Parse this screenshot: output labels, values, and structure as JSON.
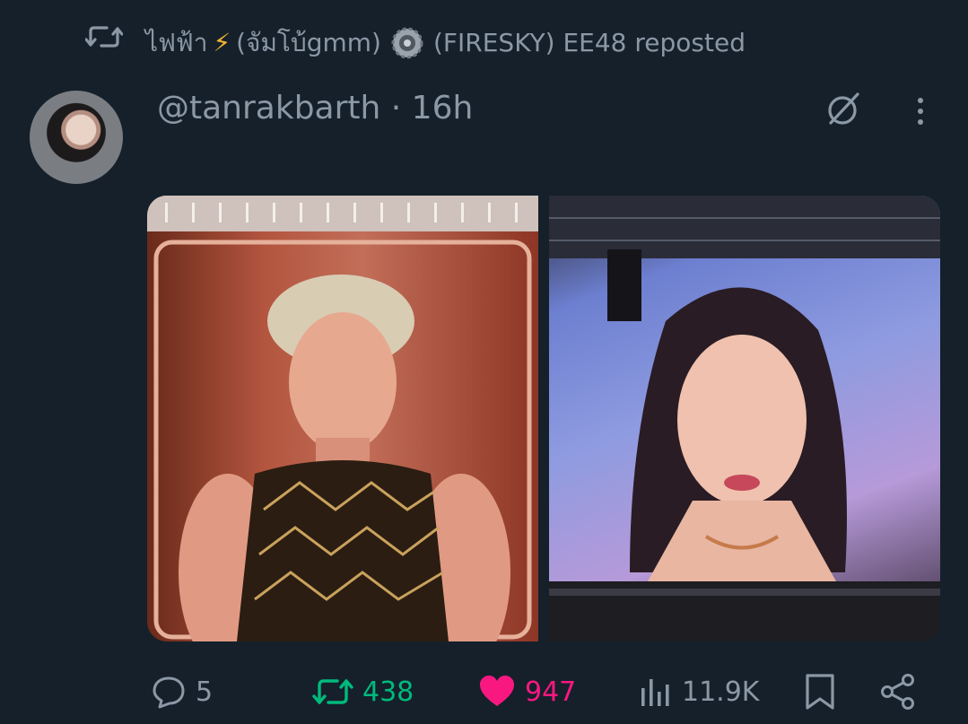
{
  "repost": {
    "name_prefix": "ไฟฟ้า",
    "bolt": "⚡",
    "name_mid": "(จัมโบ้gmm)",
    "name_suffix": "(FIRESKY) EE48 reposted"
  },
  "tweet": {
    "handle_time": "@tanrakbarth · 16h"
  },
  "actions": {
    "replies": "5",
    "reposts": "438",
    "likes": "947",
    "views": "11.9K"
  },
  "colors": {
    "background": "#15202b",
    "muted": "#8b98a5",
    "repost_green": "#00ba7c",
    "like_pink": "#f91880"
  }
}
